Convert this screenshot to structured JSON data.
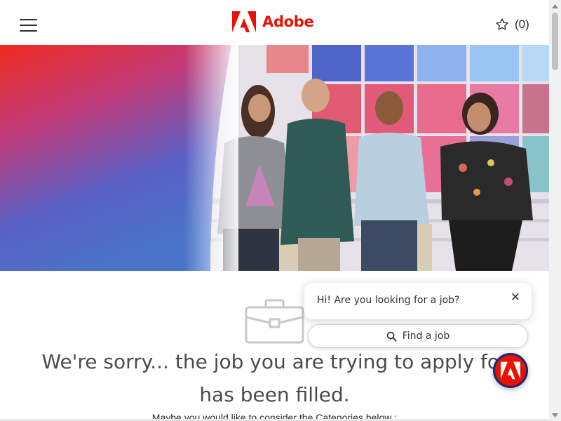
{
  "header": {
    "brand": "Adobe",
    "favorites_count": "(0)"
  },
  "icons": {
    "menu": "hamburger-icon",
    "favorites": "star-icon",
    "job": "briefcase-icon",
    "search": "search-icon",
    "close": "close-icon"
  },
  "content": {
    "sorry_message": "We're sorry... the job you are trying to apply for has been filled.",
    "consider_text": "Maybe you would like to consider the Categories below :"
  },
  "chat": {
    "greeting": "Hi! Are you looking for a job?",
    "close_label": "✕",
    "find_job_label": "Find a job"
  },
  "colors": {
    "brand": "#eb1000",
    "text": "#4b4b4b",
    "chat_ring": "#1a2a7a"
  }
}
